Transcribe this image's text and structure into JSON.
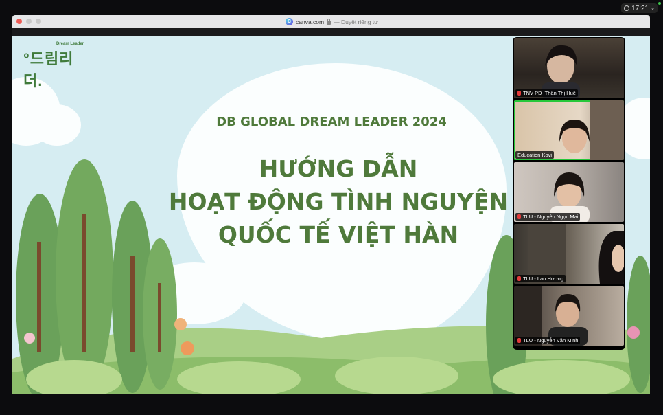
{
  "menubar": {
    "time": "17:21",
    "clock_icon": "clock-icon",
    "chevron_icon": "chevron-down-icon"
  },
  "browser": {
    "url": "canva.com",
    "mode_label": "— Duyệt riêng tư",
    "site_icon": "canva-icon",
    "lock_icon": "lock-icon"
  },
  "slide": {
    "logo_small": "Dream Leader",
    "logo_main": "°드림리더.",
    "subtitle": "DB GLOBAL DREAM LEADER 2024",
    "title_lines": [
      "HƯỚNG DẪN",
      "HOẠT ĐỘNG TÌNH NGUYỆN",
      "QUỐC TẾ VIỆT HÀN"
    ]
  },
  "participants": [
    {
      "name": "TNV PD_Thân Thị Huê",
      "muted": true,
      "active": false
    },
    {
      "name": "Education Kovi",
      "muted": false,
      "active": true
    },
    {
      "name": "TLU - Nguyễn Ngọc Mai",
      "muted": true,
      "active": false
    },
    {
      "name": "TLU - Lan Hương",
      "muted": true,
      "active": false
    },
    {
      "name": "TLU - Nguyễn Văn Minh",
      "muted": true,
      "active": false
    }
  ],
  "colors": {
    "title_green": "#4f7a3b",
    "sky": "#d6edf2",
    "active_border": "#27c73a",
    "mute_red": "#e23b3b"
  }
}
